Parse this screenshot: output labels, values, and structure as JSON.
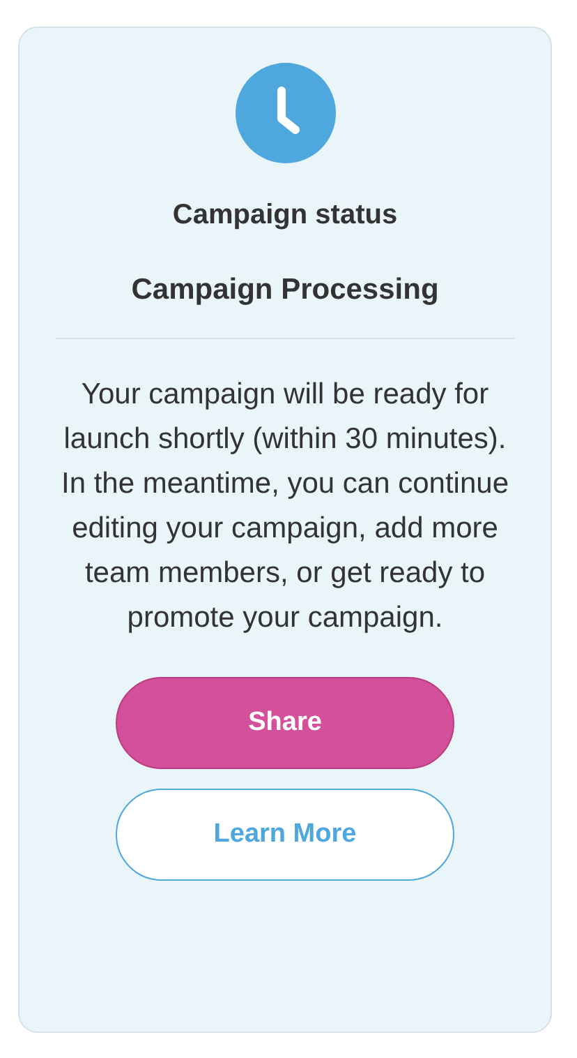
{
  "status_card": {
    "heading": "Campaign status",
    "status": "Campaign Processing",
    "message": "Your campaign will be ready for launch shortly (within 30 minutes). In the meantime, you can continue editing your campaign, add more team members, or get ready to promote your campaign.",
    "buttons": [
      {
        "label": "Share",
        "kind": "primary"
      },
      {
        "label": "Learn More",
        "kind": "secondary"
      }
    ]
  }
}
